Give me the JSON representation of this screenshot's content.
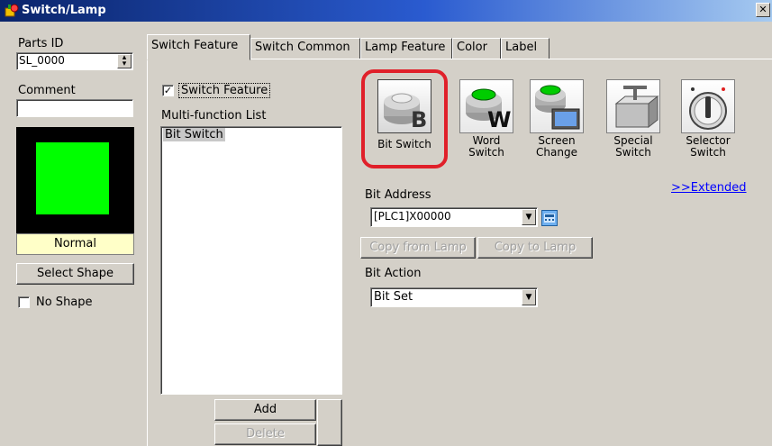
{
  "window": {
    "title": "Switch/Lamp",
    "close_glyph": "✕"
  },
  "left": {
    "parts_id_label": "Parts ID",
    "parts_id_value": "SL_0000",
    "comment_label": "Comment",
    "comment_value": "",
    "preview_state": "Normal",
    "preview_color": "#00ff00",
    "select_shape_label": "Select Shape",
    "no_shape_label": "No Shape",
    "no_shape_checked": false
  },
  "tabs": [
    {
      "label": "Switch Feature",
      "active": true
    },
    {
      "label": "Switch Common",
      "active": false
    },
    {
      "label": "Lamp Feature",
      "active": false
    },
    {
      "label": "Color",
      "active": false
    },
    {
      "label": "Label",
      "active": false
    }
  ],
  "switch_feature": {
    "enable_label": "Switch Feature",
    "enable_checked": true,
    "multi_list_label": "Multi-function List",
    "multi_list_items": [
      "Bit Switch"
    ],
    "add_label": "Add",
    "delete_label": "Delete"
  },
  "switch_types": [
    {
      "name": "bit-switch",
      "line1": "Bit Switch",
      "line2": "",
      "selected": true
    },
    {
      "name": "word-switch",
      "line1": "Word",
      "line2": "Switch",
      "selected": false
    },
    {
      "name": "screen-change",
      "line1": "Screen",
      "line2": "Change",
      "selected": false
    },
    {
      "name": "special-switch",
      "line1": "Special",
      "line2": "Switch",
      "selected": false
    },
    {
      "name": "selector-switch",
      "line1": "Selector",
      "line2": "Switch",
      "selected": false
    }
  ],
  "extended_link": ">>Extended",
  "bit_address": {
    "label": "Bit Address",
    "value": "[PLC1]X00000"
  },
  "copy_from_lamp": "Copy from Lamp",
  "copy_to_lamp": "Copy to Lamp",
  "bit_action": {
    "label": "Bit Action",
    "value": "Bit Set"
  },
  "colors": {
    "highlight": "#e0202a",
    "accent_green": "#00cc00",
    "titlebar": "#0a246a"
  }
}
